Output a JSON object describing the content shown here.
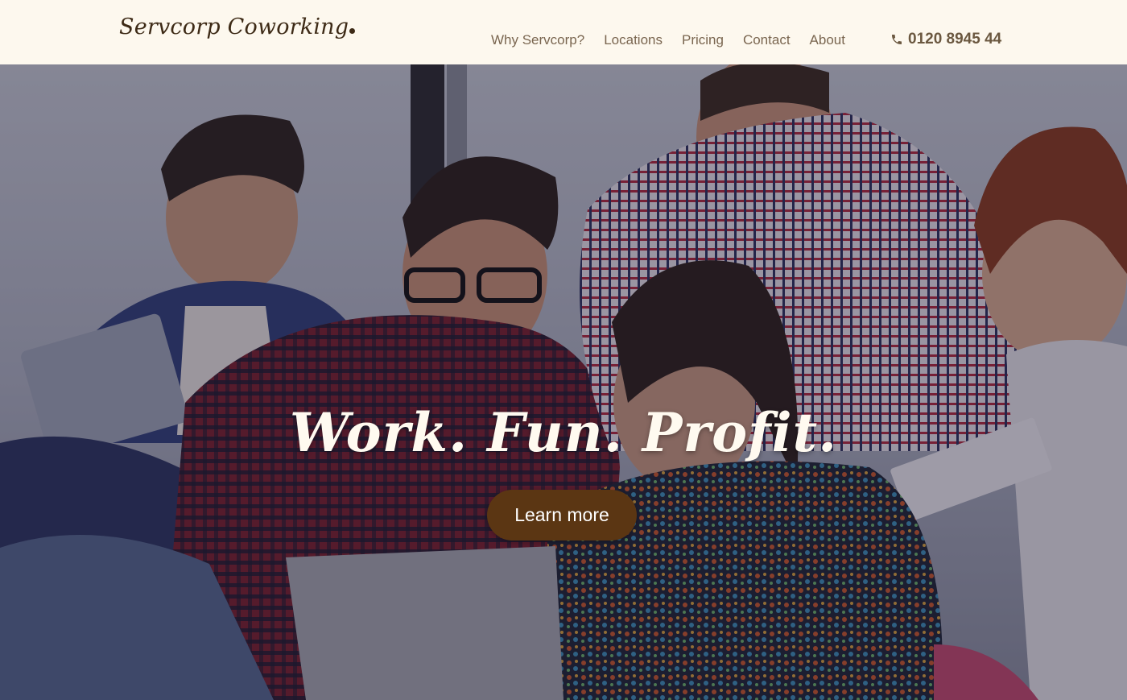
{
  "brand": {
    "name": "Servcorp Coworking"
  },
  "nav": {
    "links": [
      "Why Servcorp?",
      "Locations",
      "Pricing",
      "Contact",
      "About"
    ],
    "phone": "0120 8945 44"
  },
  "hero": {
    "headline": "Work. Fun. Profit.",
    "cta_label": "Learn more"
  },
  "colors": {
    "nav_background": "#fdf8ee",
    "brand_text": "#3d2a16",
    "nav_text": "#7a6650",
    "cta_background": "#5b3613",
    "headline_text": "#fffaf0"
  },
  "icons": {
    "phone": "phone-icon"
  }
}
